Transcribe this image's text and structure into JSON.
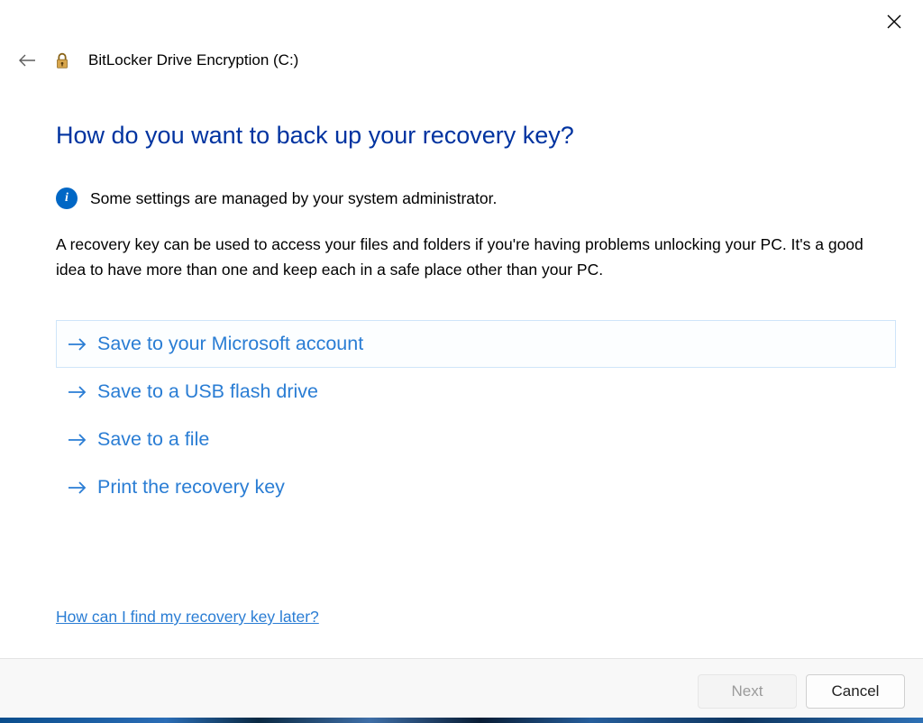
{
  "window": {
    "title": "BitLocker Drive Encryption (C:)"
  },
  "heading": "How do you want to back up your recovery key?",
  "info_message": "Some settings are managed by your system administrator.",
  "description": "A recovery key can be used to access your files and folders if you're having problems unlocking your PC. It's a good idea to have more than one and keep each in a safe place other than your PC.",
  "options": [
    {
      "label": "Save to your Microsoft account",
      "selected": true
    },
    {
      "label": "Save to a USB flash drive",
      "selected": false
    },
    {
      "label": "Save to a file",
      "selected": false
    },
    {
      "label": "Print the recovery key",
      "selected": false
    }
  ],
  "help_link": "How can I find my recovery key later?",
  "footer": {
    "next_label": "Next",
    "cancel_label": "Cancel",
    "next_enabled": false
  }
}
